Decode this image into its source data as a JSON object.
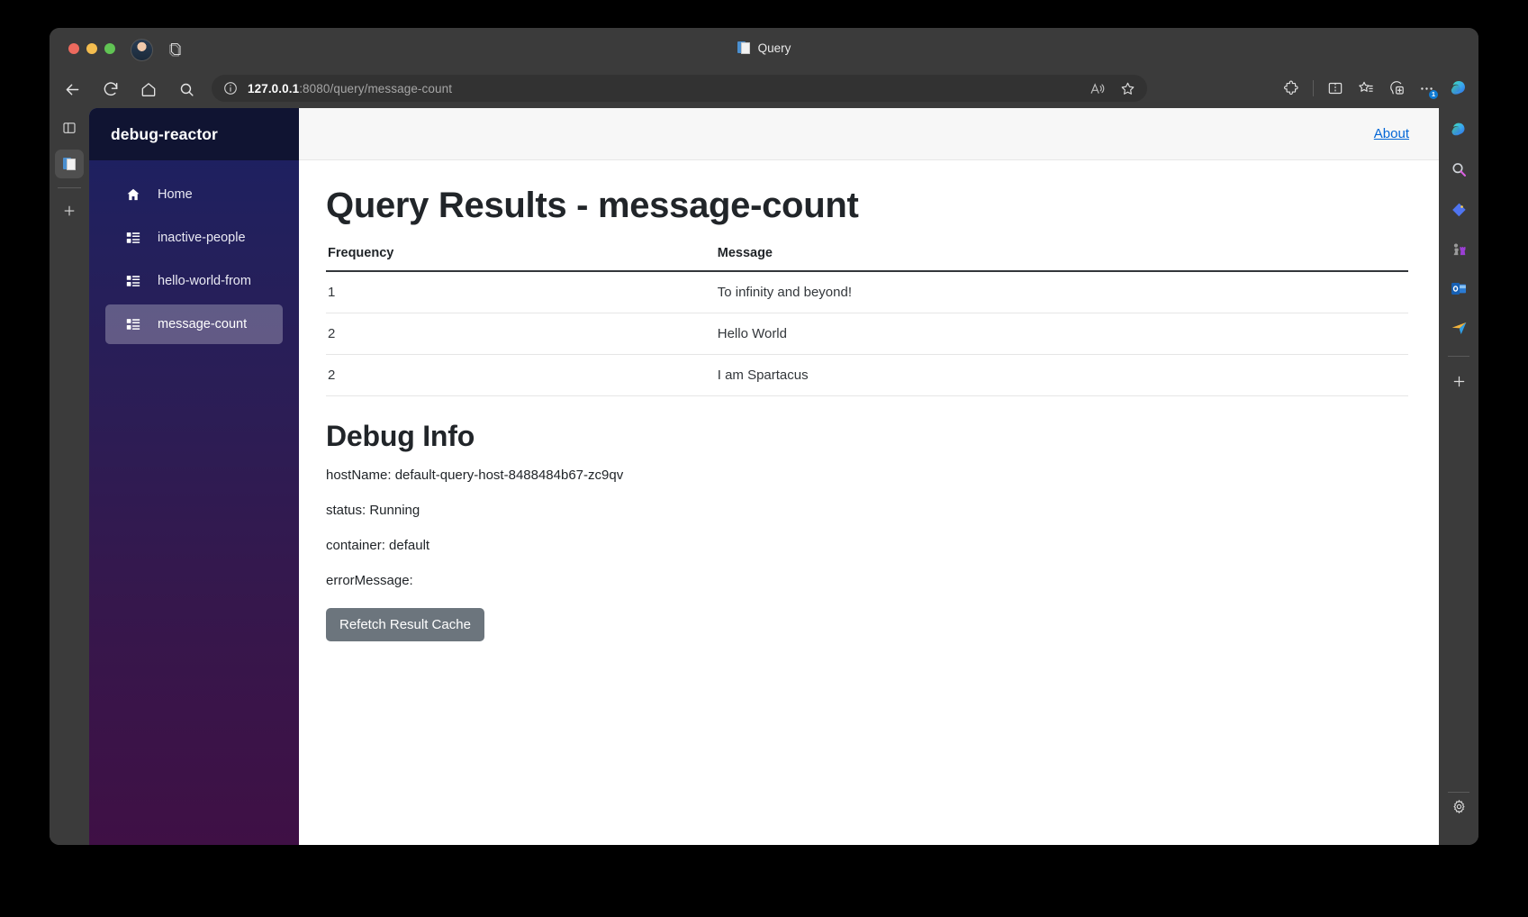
{
  "browser": {
    "tab_title": "Query",
    "tab_favicon_icon": "document-icon",
    "url_host": "127.0.0.1",
    "url_path": ":8080/query/message-count",
    "toolbar": {
      "back_icon": "back-arrow-icon",
      "reload_icon": "reload-icon",
      "home_icon": "home-icon",
      "search_icon": "search-icon",
      "info_icon": "site-info-icon",
      "read_aloud_icon": "read-aloud-icon",
      "favorite_icon": "favorite-star-icon",
      "extensions_icon": "extensions-puzzle-icon",
      "split_screen_icon": "split-screen-icon",
      "collections_icon": "collections-icon",
      "add_tab_group_icon": "add-tab-group-icon",
      "more_icon": "more-options-icon",
      "more_badge": "1",
      "copilot_icon": "copilot-icon"
    },
    "vertical_tabstrip": {
      "collapse_icon": "collapse-tabstrip-icon",
      "active_tab_icon": "document-icon",
      "new_tab_icon": "plus-icon"
    },
    "edge_sidebar": {
      "items": [
        {
          "icon": "copilot-icon",
          "label": "Copilot"
        },
        {
          "icon": "search-icon",
          "label": "Search"
        },
        {
          "icon": "shopping-tag-icon",
          "label": "Shopping"
        },
        {
          "icon": "games-icon",
          "label": "Games"
        },
        {
          "icon": "outlook-icon",
          "label": "Outlook"
        },
        {
          "icon": "send-icon",
          "label": "Drop"
        },
        {
          "icon": "plus-icon",
          "label": "Customize"
        }
      ],
      "settings_icon": "gear-icon"
    }
  },
  "app": {
    "brand": "debug-reactor",
    "sidebar": {
      "items": [
        {
          "label": "Home",
          "icon": "home-icon",
          "active": false
        },
        {
          "label": "inactive-people",
          "icon": "list-icon",
          "active": false
        },
        {
          "label": "hello-world-from",
          "icon": "list-icon",
          "active": false
        },
        {
          "label": "message-count",
          "icon": "list-icon",
          "active": true
        }
      ]
    },
    "topbar": {
      "about_label": "About"
    },
    "results": {
      "heading": "Query Results - message-count",
      "columns": [
        "Frequency",
        "Message"
      ],
      "rows": [
        {
          "frequency": "1",
          "message": "To infinity and beyond!"
        },
        {
          "frequency": "2",
          "message": "Hello World"
        },
        {
          "frequency": "2",
          "message": "I am Spartacus"
        }
      ]
    },
    "debug": {
      "heading": "Debug Info",
      "host_name": "hostName: default-query-host-8488484b67-zc9qv",
      "status": "status: Running",
      "container": "container: default",
      "error_message": "errorMessage:",
      "refetch_label": "Refetch Result Cache"
    }
  },
  "colors": {
    "sidebar_top": "#1b2062",
    "sidebar_bottom": "#3f1045",
    "brand_bar": "#101432",
    "link": "#0366d6",
    "button": "#6c757d",
    "chrome": "#3b3b3b"
  }
}
